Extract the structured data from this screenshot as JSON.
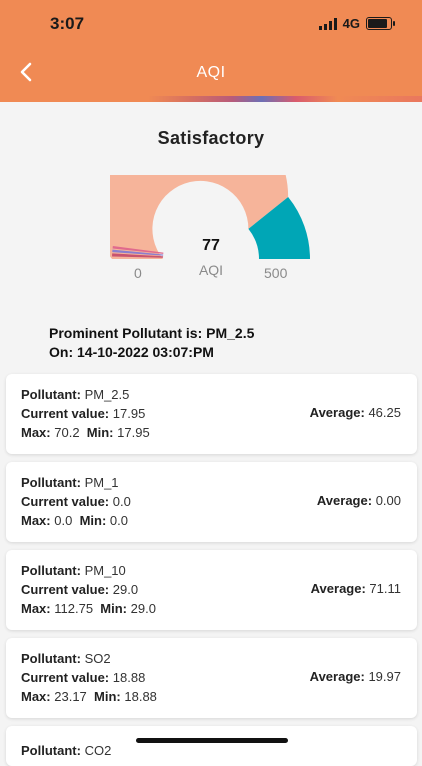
{
  "status_bar": {
    "time": "3:07",
    "network": "4G"
  },
  "header": {
    "title": "AQI",
    "back_icon": "chevron-left-icon"
  },
  "aqi": {
    "category": "Satisfactory",
    "value": "77",
    "unit": "AQI",
    "min": "0",
    "max": "500",
    "gauge_level": 0.154,
    "colors": {
      "good_band": "#f6b49a",
      "current_band": "#00a6b6",
      "accent_lines": [
        "#c8546f",
        "#8a7fcf",
        "#e06a8d"
      ]
    }
  },
  "prominent": {
    "line1": "Prominent Pollutant is: PM_2.5",
    "line2": "On: 14-10-2022 03:07:PM"
  },
  "labels": {
    "pollutant": "Pollutant:",
    "current": "Current value:",
    "max": "Max:",
    "min": "Min:",
    "average": "Average:"
  },
  "pollutants": [
    {
      "name": "PM_2.5",
      "current": "17.95",
      "max": "70.2",
      "min": "17.95",
      "average": "46.25"
    },
    {
      "name": "PM_1",
      "current": "0.0",
      "max": "0.0",
      "min": "0.0",
      "average": "0.00"
    },
    {
      "name": "PM_10",
      "current": "29.0",
      "max": "112.75",
      "min": "29.0",
      "average": "71.11"
    },
    {
      "name": "SO2",
      "current": "18.88",
      "max": "23.17",
      "min": "18.88",
      "average": "19.97"
    },
    {
      "name": "CO2"
    }
  ],
  "theme": {
    "header_color": "#f08a54",
    "background": "#f4f4f4"
  }
}
